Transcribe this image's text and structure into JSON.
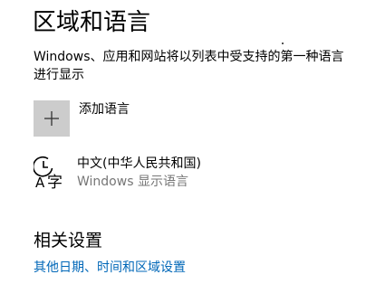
{
  "page": {
    "title": "区域和语言",
    "description": "Windows、应用和网站将以列表中受支持的第一种语言进行显示"
  },
  "add_language": {
    "label": "添加语言",
    "icon": "plus-icon"
  },
  "languages": [
    {
      "name": "中文(中华人民共和国)",
      "subtitle": "Windows 显示语言",
      "icon": "language-display-icon"
    }
  ],
  "related": {
    "title": "相关设置",
    "link_label": "其他日期、时间和区域设置"
  },
  "colors": {
    "link": "#0067b8",
    "add_box": "#cccccc",
    "secondary_text": "#767676"
  }
}
